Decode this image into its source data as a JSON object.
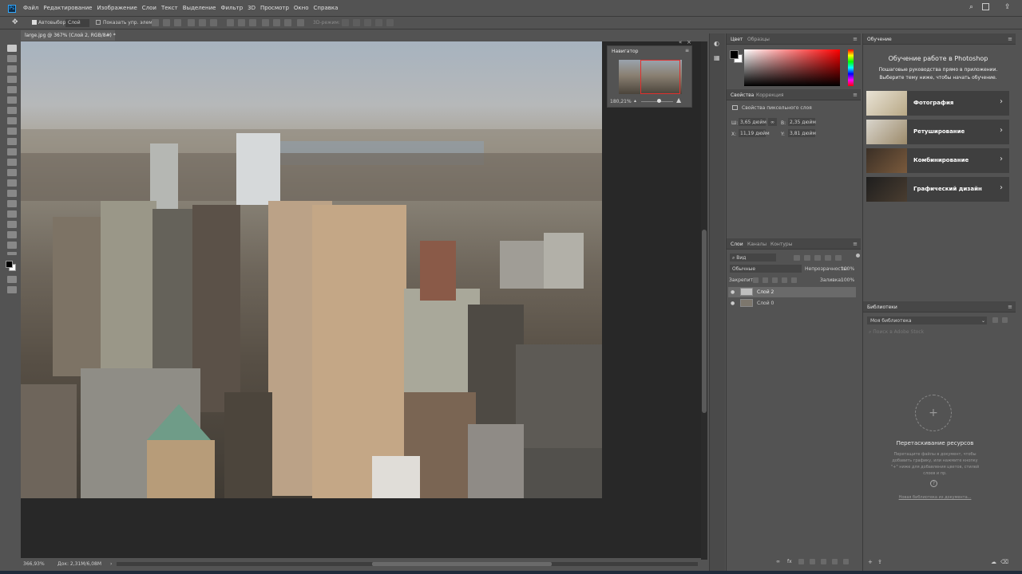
{
  "app": {
    "logo": "Ps"
  },
  "menu": [
    "Файл",
    "Редактирование",
    "Изображение",
    "Слои",
    "Текст",
    "Выделение",
    "Фильтр",
    "3D",
    "Просмотр",
    "Окно",
    "Справка"
  ],
  "window_controls": [
    "—",
    "☐",
    "✕"
  ],
  "options_bar": {
    "autoselect_label": "Автовыбор:",
    "autoselect_value": "Слой",
    "show_controls_label": "Показать упр. элем.",
    "mode_3d": "3D-режим:"
  },
  "document": {
    "tab_title": "large.jpg @ 367% (Слой 2, RGB/8#) *",
    "zoom_status": "366,93%",
    "doc_status": "Док: 2,31M/6,08M"
  },
  "navigator": {
    "title": "Навигатор",
    "zoom": "180,21%"
  },
  "color_panel": {
    "tabs": [
      "Цвет",
      "Образцы"
    ],
    "fg_color": "#000000",
    "bg_color": "#ffffff"
  },
  "properties_panel": {
    "tabs": [
      "Свойства",
      "Коррекция"
    ],
    "section": "Свойства пиксельного слоя",
    "w_label": "Ш:",
    "w_value": "3,65 дюйм",
    "h_label": "В:",
    "h_value": "2,35 дюйм",
    "x_label": "X:",
    "x_value": "11,19 дюйм",
    "y_label": "Y:",
    "y_value": "3,81 дюйм"
  },
  "layers_panel": {
    "tabs": [
      "Слои",
      "Каналы",
      "Контуры"
    ],
    "filter": "Вид",
    "blend_mode": "Обычные",
    "opacity_label": "Непрозрачность:",
    "opacity_value": "100%",
    "lock_label": "Закрепить:",
    "fill_label": "Заливка:",
    "fill_value": "100%",
    "layers": [
      {
        "name": "Слой 2",
        "selected": true
      },
      {
        "name": "Слой 0",
        "selected": false
      }
    ]
  },
  "learn_panel": {
    "tab": "Обучение",
    "title": "Обучение работе в Photoshop",
    "subtitle_line1": "Пошаговые руководства прямо в приложении.",
    "subtitle_line2": "Выберите тему ниже, чтобы начать обучение.",
    "topics": [
      "Фотография",
      "Ретуширование",
      "Комбинирование",
      "Графический дизайн"
    ]
  },
  "libraries_panel": {
    "tab": "Библиотеки",
    "library": "Моя библиотека",
    "search_placeholder": "Поиск в Adobe Stock",
    "drag_title": "Перетаскивание ресурсов",
    "drag_text_1": "Перетащите файлы в документ, чтобы",
    "drag_text_2": "добавить графику, или нажмите кнопку",
    "drag_text_3": "\"+\" ниже для добавления цветов, стилей",
    "drag_text_4": "слоев и пр.",
    "help_icon": "?",
    "new_library_link": "Новая библиотека из документа..."
  }
}
